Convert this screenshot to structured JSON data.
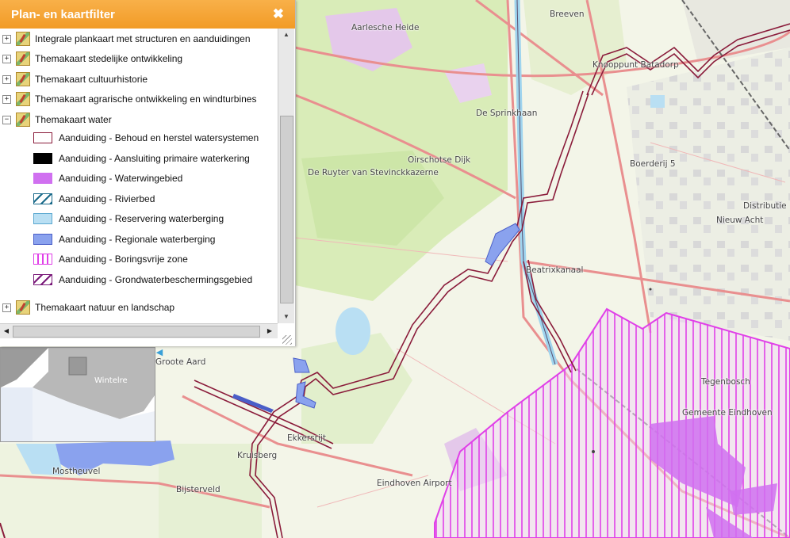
{
  "panel": {
    "title": "Plan- en kaartfilter",
    "close_icon": "close-icon",
    "layers": [
      {
        "label": "Integrale plankaart met structuren en aanduidingen",
        "expanded": false
      },
      {
        "label": "Themakaart stedelijke ontwikkeling",
        "expanded": false
      },
      {
        "label": "Themakaart cultuurhistorie",
        "expanded": false
      },
      {
        "label": "Themakaart agrarische ontwikkeling en windturbines",
        "expanded": false
      },
      {
        "label": "Themakaart water",
        "expanded": true
      },
      {
        "label": "Themakaart natuur en landschap",
        "expanded": false
      }
    ],
    "legend": [
      {
        "label": "Aanduiding - Behoud en herstel watersystemen",
        "style": "outline-maroon"
      },
      {
        "label": "Aanduiding - Aansluiting primaire waterkering",
        "style": "solid-black"
      },
      {
        "label": "Aanduiding - Waterwingebied",
        "style": "solid-violet"
      },
      {
        "label": "Aanduiding - Rivierbed",
        "style": "hatch-teal"
      },
      {
        "label": "Aanduiding - Reservering waterberging",
        "style": "solid-lightblue"
      },
      {
        "label": "Aanduiding - Regionale waterberging",
        "style": "solid-blue"
      },
      {
        "label": "Aanduiding - Boringsvrije zone",
        "style": "vlines-magenta"
      },
      {
        "label": "Aanduiding - Grondwaterbeschermingsgebied",
        "style": "hatch-purple"
      }
    ]
  },
  "map": {
    "places": [
      {
        "name": "Breeven"
      },
      {
        "name": "Aarlesche Heide"
      },
      {
        "name": "Knooppunt Batadorp"
      },
      {
        "name": "De Sprinkhaan"
      },
      {
        "name": "Oirschotse Dijk"
      },
      {
        "name": "De Ruyter van Stevinckkazerne"
      },
      {
        "name": "Boerderij 5"
      },
      {
        "name": "Distributie"
      },
      {
        "name": "Nieuw Acht"
      },
      {
        "name": "Beatrixkanaal"
      },
      {
        "name": "Tegenbosch"
      },
      {
        "name": "Gemeente Eindhoven"
      },
      {
        "name": "Groote Aard"
      },
      {
        "name": "Ekkersrijt"
      },
      {
        "name": "Kruisberg"
      },
      {
        "name": "Mostheuvel"
      },
      {
        "name": "Bijsterveld"
      },
      {
        "name": "Eindhoven Airport"
      },
      {
        "name": "Wintelre"
      }
    ],
    "colors": {
      "land": "#f3f5e8",
      "green": "#d9ecb8",
      "purple": "#e4c8ea",
      "water": "#b9dff3",
      "road": "#e98f8f",
      "maroon": "#8a1b3a",
      "magenta": "#e040e8",
      "violet": "#d070f0",
      "regional": "#8aa2ee"
    }
  }
}
